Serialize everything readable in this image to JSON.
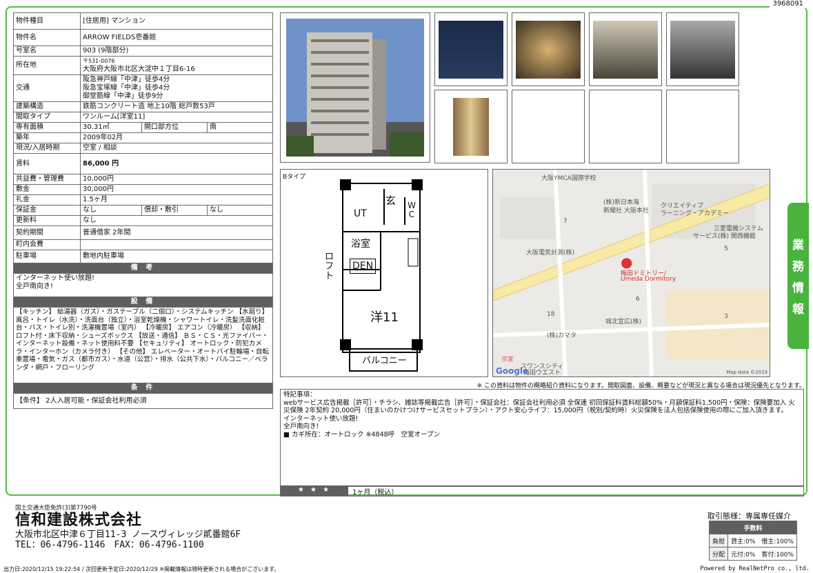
{
  "property_id": "3968091",
  "specs": {
    "type_label": "物件種目",
    "type_value": "[住居用] マンション",
    "name_label": "物件名",
    "name_value": "ARROW FIELDS壱番館",
    "room_label": "号室名",
    "room_value": "903 (9階部分)",
    "addr_label": "所在地",
    "zip": "〒531-0076",
    "addr_value": "大阪府大阪市北区大淀中１丁目6-16",
    "traffic_label": "交通",
    "traffic": [
      "阪急神戸線「中津」徒歩4分",
      "阪急宝塚線「中津」徒歩4分",
      "御堂筋線「中津」徒歩9分"
    ],
    "struct_label": "建築構造",
    "struct_value": "鉄筋コンクリート造 地上10階 総戸数53戸",
    "layout_label": "間取タイプ",
    "layout_value": "ワンルーム[洋室11]",
    "area_label": "専有面積",
    "area_value": "30.31㎡",
    "opening_label": "開口部方位",
    "opening_value": "南",
    "built_label": "築年",
    "built_value": "2009年02月",
    "status_label": "現況/入居時期",
    "status_value": "空室 / 相談",
    "rent_label": "賃料",
    "rent_value": "86,000 円",
    "common_label": "共益費・管理費",
    "common_value": "10,000円",
    "deposit_label": "敷金",
    "deposit_value": "30,000円",
    "key_label": "礼金",
    "key_value": "1.5ヶ月",
    "guarantee_label": "保証金",
    "guarantee_value": "なし",
    "amort_label": "償却・敷引",
    "amort_value": "なし",
    "renew_label": "更新料",
    "renew_value": "なし",
    "contract_label": "契約期間",
    "contract_value": "普通借家 2年間",
    "town_label": "町内会費",
    "town_value": "",
    "parking_label": "駐車場",
    "parking_value": "敷地内駐車場",
    "remarks_header": "備 考",
    "remarks": [
      "インターネット使い放題!",
      "全戸南向き!"
    ],
    "equip_header": "設 備",
    "equip_text": "【キッチン】 給湯器（ガス）・ガステーブル（二個口）・システムキッチン 【水廻り】 風呂・トイレ（水洗）・洗面台（独立）・浴室乾燥機・シャワートイレ・洗髪洗面化粧台・バス・トイレ別・洗濯機置場（室内） 【冷暖房】 エアコン（冷暖房） 【収納】 ロフト付・床下収納・シューズボックス 【放送・通信】 ＢＳ・ＣＳ・光ファイバー・インターネット設備・ネット使用料不要 【セキュリティ】 オートロック・防犯カメラ・インターホン（カメラ付き） 【その他】 エレベーター・オートバイ駐輪場・自転車置場・電気・ガス（都市ガス）・水道（公営）・排水（公共下水）・バルコニー／ベランダ・網戸・フローリング",
    "cond_header": "条 件",
    "cond_text": "【条件】 2人入居可能・保証会社利用必須"
  },
  "floorplan": {
    "type_label": "Bタイプ",
    "rooms": {
      "genkan": "玄",
      "ut": "UT",
      "wc": "W C",
      "bath": "浴室",
      "loft": "ロフト",
      "den": "DEN",
      "western": "洋11",
      "balcony": "バルコニー"
    }
  },
  "map": {
    "labels": [
      "大阪YMCA国際学校",
      "(株)新日本海",
      "新聞社 大阪本社",
      "クリエイティブ",
      "ラーニング・アカデミー",
      "三菱電機システム",
      "サービス(株) 関西機能",
      "大阪電気計測(株)",
      "梅田ドミトリー/",
      "Umeda Dormitory",
      "城北宣広(株)",
      "(株)カマタ",
      "スワンスシティ",
      "梅田ウエスト",
      "宗家",
      "7",
      "5",
      "6",
      "18",
      "3"
    ],
    "credit": "Map data ©2019",
    "google": "Google"
  },
  "disclaimer": "※ この資料は物件の概略紹介資料になります。間取図面、設備、概要などが現況と異なる場合は現況優先となります。",
  "notes": {
    "header": "特記事項：",
    "lines": [
      "webサービス広告掲載［許可］・チラシ、雑誌等掲載広告［許可］・保証会社：保証会社利用必須 全保連 初回保証料賃料総額50%・月額保証料1,500円・保険：保険要加入 火災保険 2年契約 20,000円（住まいのかけつけサービスセットプラン）・アクト安心ライフ：15,000円（税別/契約時）火災保険を法人包括保険使用の際にご加入頂きます。",
      "インターネット使い放題!",
      "全戸南向き!",
      "■ カギ所在：オートロック ※4848呼　空室オープン"
    ]
  },
  "stars": {
    "label": "★ ★ ★",
    "text": "1ヶ月（税込）"
  },
  "side_tab": [
    "業",
    "務",
    "情",
    "報"
  ],
  "company": {
    "license": "国土交通大臣免許(3)第7790号",
    "name": "信和建設株式会社",
    "address": "大阪市北区中津６丁目11-3 ノースヴィレッジ貳番館6F",
    "tel": "TEL：06-4796-1146　FAX：06-4796-1100"
  },
  "deal": {
    "label": "取引態様：専属専任媒介",
    "fee_header": "手数料",
    "rows": [
      {
        "k": "負担",
        "v": "貸主:0%　借主:100%"
      },
      {
        "k": "分配",
        "v": "元付:0%　客付:100%"
      }
    ]
  },
  "footer": {
    "left": "出力日:2020/12/15 19:22:54 / 次回更新予定日:2020/12/29 ※掲載情報は随時更新される場合がございます。",
    "right": "Powered by RealNetPro co., ltd."
  }
}
